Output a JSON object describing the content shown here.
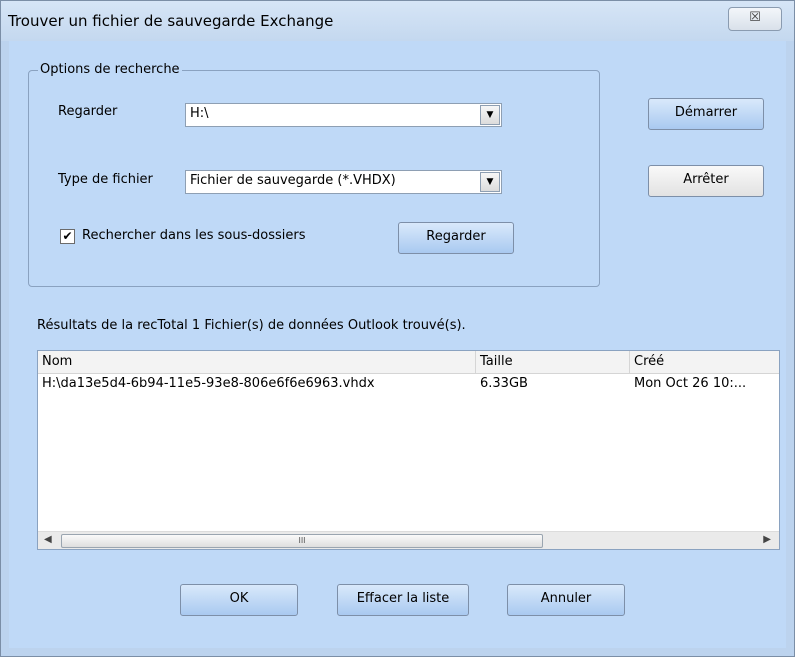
{
  "window": {
    "title": "Trouver un fichier de sauvegarde Exchange",
    "close_glyph": "☒"
  },
  "search_options": {
    "legend": "Options de recherche",
    "look_in_label": "Regarder",
    "look_in_value": "H:\\",
    "file_type_label": "Type de fichier",
    "file_type_value": "Fichier de sauvegarde (*.VHDX)",
    "subfolders_label": "Rechercher dans les sous-dossiers",
    "subfolders_checked": true,
    "browse_label": "Regarder"
  },
  "actions": {
    "start_label": "Démarrer",
    "stop_label": "Arrêter"
  },
  "results": {
    "status_text": "Résultats de la recTotal 1 Fichier(s) de données Outlook trouvé(s).",
    "columns": [
      "Nom",
      "Taille",
      "Créé"
    ],
    "rows": [
      {
        "name": "H:\\da13e5d4-6b94-11e5-93e8-806e6f6e6963.vhdx",
        "size": "6.33GB",
        "created": "Mon Oct 26 10:..."
      }
    ],
    "scroll_grip": "III"
  },
  "footer": {
    "ok_label": "OK",
    "clear_label": "Effacer la liste",
    "cancel_label": "Annuler"
  }
}
